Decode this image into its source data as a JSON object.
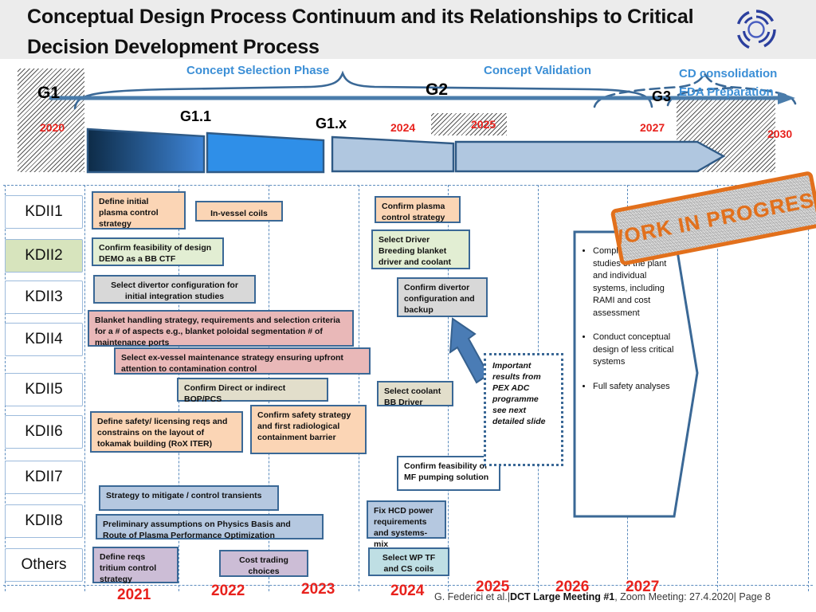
{
  "slide": {
    "title": "Conceptual Design Process Continuum and its Relationships to Critical Decision Development Process",
    "logo_name": "eurofusion-ring-logo",
    "footer": {
      "authors": "G. Federici et al.|",
      "meeting": "DCT Large Meeting #1",
      "rest": ", Zoom Meeting: 27.4.2020|  Page 8"
    }
  },
  "timeline": {
    "gates": [
      {
        "id": "G1",
        "label": "G1"
      },
      {
        "id": "G2",
        "label": "G2"
      },
      {
        "id": "G3",
        "label": "G3"
      },
      {
        "id": "G11",
        "label": "G1.1"
      },
      {
        "id": "G1x",
        "label": "G1.x"
      }
    ],
    "phases": [
      {
        "label": "Concept Selection Phase"
      },
      {
        "label": "Concept Validation"
      }
    ],
    "cd_consolidation_line1": "CD consolidation",
    "cd_consolidation_line2": "EDA Preparation",
    "top_years": [
      "2020",
      "2024",
      "2025",
      "2027",
      "2030"
    ],
    "bottom_years": [
      "2021",
      "2022",
      "2023",
      "2024",
      "2025",
      "2026",
      "2027"
    ],
    "accent_blue": "#3c8fd6",
    "year_red": "#e8221d"
  },
  "rows": {
    "labels": [
      {
        "id": "kdii1",
        "text": "KDII1",
        "highlight": false
      },
      {
        "id": "kdii2",
        "text": "KDII2",
        "highlight": true
      },
      {
        "id": "kdii3",
        "text": "KDII3",
        "highlight": false
      },
      {
        "id": "kdii4",
        "text": "KDII4",
        "highlight": false
      },
      {
        "id": "kdii5",
        "text": "KDII5",
        "highlight": false
      },
      {
        "id": "kdii6",
        "text": "KDII6",
        "highlight": false
      },
      {
        "id": "kdii7",
        "text": "KDII7",
        "highlight": false
      },
      {
        "id": "kdii8",
        "text": "KDII8",
        "highlight": false
      },
      {
        "id": "others",
        "text": "Others",
        "highlight": false
      }
    ]
  },
  "tasks": {
    "define_initial_plasma": "Define initial plasma control strategy",
    "in_vessel_coils": "In-vessel coils",
    "confirm_plasma_control": "Confirm plasma control strategy",
    "confirm_feasibility_demo": "Confirm feasibility of design DEMO as a BB CTF",
    "select_driver_bb": "Select Driver Breeding blanket driver  and coolant",
    "select_divertor_config": "Select divertor configuration for initial integration studies",
    "confirm_divertor_config": "Confirm divertor configuration and backup",
    "blanket_handling": "Blanket handling strategy, requirements and selection criteria for a # of aspects e.g., blanket poloidal segmentation # of maintenance ports",
    "select_ex_vessel": "Select ex-vessel maintenance strategy ensuring upfront attention to contamination control",
    "confirm_direct_bop": "Confirm Direct or indirect BOP/PCS",
    "select_coolant_bb": "Select coolant BB Driver",
    "define_safety_licensing": "Define safety/ licensing reqs and constrains on the layout of tokamak building (RoX ITER)",
    "confirm_safety_strategy": "Confirm safety strategy and first radiological containment barrier",
    "confirm_mf_pumping": "Confirm feasibility of  MF pumping solution",
    "strategy_transients": "Strategy to mitigate / control transients",
    "fix_hcd_power": "Fix HCD power requirements and systems-mix",
    "preliminary_assumptions": "Preliminary assumptions on Physics Basis and Route of  Plasma Performance Optimization",
    "define_reqs_tritium": "Define reqs tritium control strategy",
    "cost_trading": "Cost trading choices",
    "select_wp_tf": "Select WP TF and CS coils"
  },
  "note": {
    "text": "Important results from PEX ADC programme see next detailed slide"
  },
  "right_panel": {
    "bullets": [
      "Complete integration studies of the plant and individual systems, including RAMI and cost assessment",
      "Conduct conceptual design of less critical systems",
      "Full safety analyses"
    ]
  },
  "stamp": {
    "text": "WORK IN PROGRESS",
    "color": "#e2701c"
  }
}
